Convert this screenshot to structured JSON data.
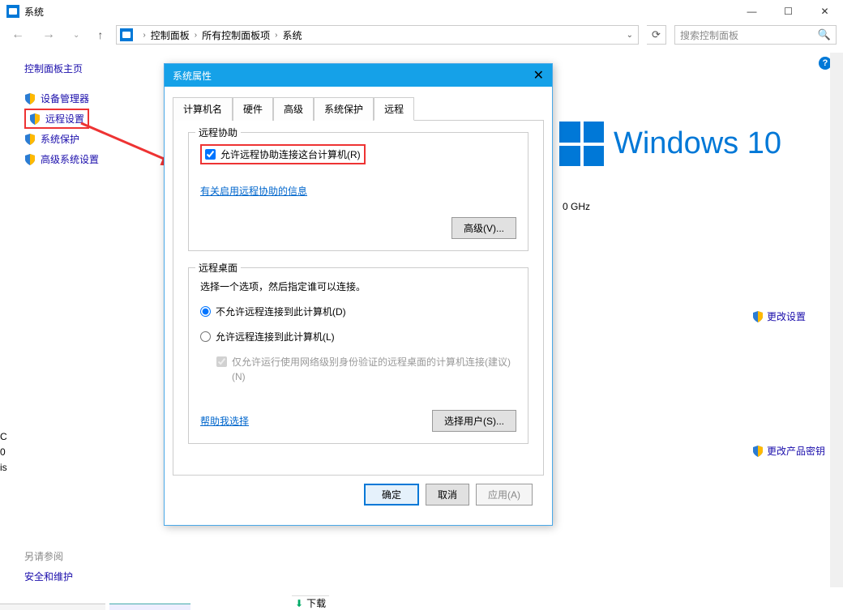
{
  "window": {
    "title": "系统",
    "min": "—",
    "max": "☐",
    "close": "✕"
  },
  "nav": {
    "back": "←",
    "forward": "→",
    "up": "↑",
    "crumbs": [
      "控制面板",
      "所有控制面板项",
      "系统"
    ],
    "dropdown": "⌄",
    "refresh": "⟳",
    "search_placeholder": "搜索控制面板",
    "search_icon": "🔍"
  },
  "help_tooltip": "?",
  "sidebar": {
    "home": "控制面板主页",
    "items": [
      {
        "label": "设备管理器"
      },
      {
        "label": "远程设置",
        "highlight": true
      },
      {
        "label": "系统保护"
      },
      {
        "label": "高级系统设置"
      }
    ]
  },
  "bg": {
    "win_text": "Windows 10",
    "ghz": "0 GHz",
    "change_settings": "更改设置",
    "change_key": "更改产品密钥",
    "cutoff1": "C",
    "cutoff2": "0",
    "cutoff3": "is"
  },
  "see_also": {
    "header": "另请参阅",
    "link": "安全和维护"
  },
  "dialog": {
    "title": "系统属性",
    "close": "✕",
    "tabs": [
      "计算机名",
      "硬件",
      "高级",
      "系统保护",
      "远程"
    ],
    "active_tab": 4,
    "remote_assist": {
      "legend": "远程协助",
      "checkbox_label": "允许远程协助连接这台计算机(R)",
      "info_link": "有关启用远程协助的信息",
      "advanced_btn": "高级(V)..."
    },
    "remote_desktop": {
      "legend": "远程桌面",
      "desc": "选择一个选项，然后指定谁可以连接。",
      "radio1": "不允许远程连接到此计算机(D)",
      "radio2": "允许远程连接到此计算机(L)",
      "sub_check": "仅允许运行使用网络级别身份验证的远程桌面的计算机连接(建议)(N)",
      "help_link": "帮助我选择",
      "select_users_btn": "选择用户(S)..."
    },
    "footer": {
      "ok": "确定",
      "cancel": "取消",
      "apply": "应用(A)"
    }
  },
  "task": {
    "downloads": "下载"
  }
}
